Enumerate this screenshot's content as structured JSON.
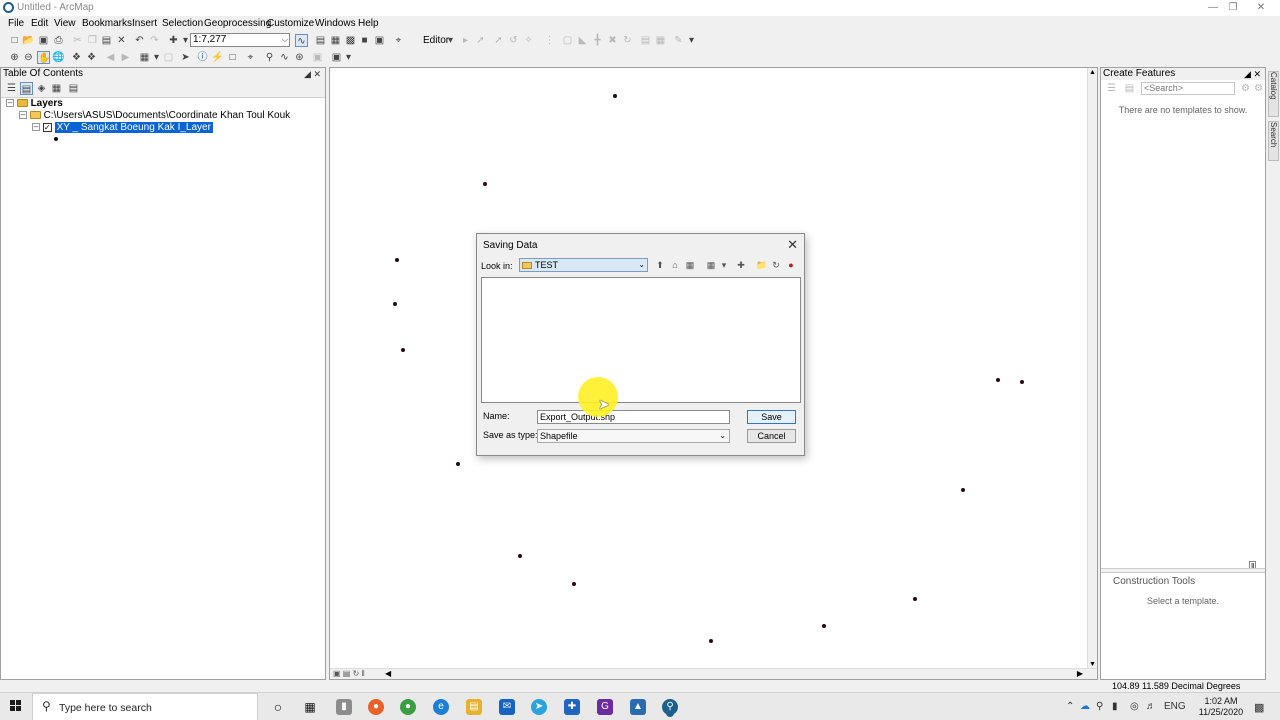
{
  "window": {
    "title": "Untitled - ArcMap"
  },
  "menu": [
    "File",
    "Edit",
    "View",
    "Bookmarks",
    "Insert",
    "Selection",
    "Geoprocessing",
    "Customize",
    "Windows",
    "Help"
  ],
  "toolbar": {
    "scale": "1:7,277",
    "editor_label": "Editor"
  },
  "toc": {
    "title": "Table Of Contents",
    "layers_label": "Layers",
    "folder_path": "C:\\Users\\ASUS\\Documents\\Coordinate Khan Toul Kouk",
    "layer_name": "XY _ Sangkat Boeung Kak I_Layer"
  },
  "create_features": {
    "title": "Create Features",
    "search_placeholder": "<Search>",
    "no_templates": "There are no templates to show.",
    "construction_tools": "Construction Tools",
    "select_template": "Select a template."
  },
  "side_tabs": [
    "Catalog",
    "Search"
  ],
  "dialog": {
    "title": "Saving Data",
    "look_in_label": "Look in:",
    "look_in_value": "TEST",
    "name_label": "Name:",
    "name_value": "Export_Output.shp",
    "save_as_type_label": "Save as type:",
    "save_as_type_value": "Shapefile",
    "save_button": "Save",
    "cancel_button": "Cancel"
  },
  "status": {
    "coordinates": "104.89  11.589 Decimal Degrees"
  },
  "taskbar": {
    "search_placeholder": "Type here to search",
    "language": "ENG",
    "time": "1:02 AM",
    "date": "11/25/2020"
  }
}
